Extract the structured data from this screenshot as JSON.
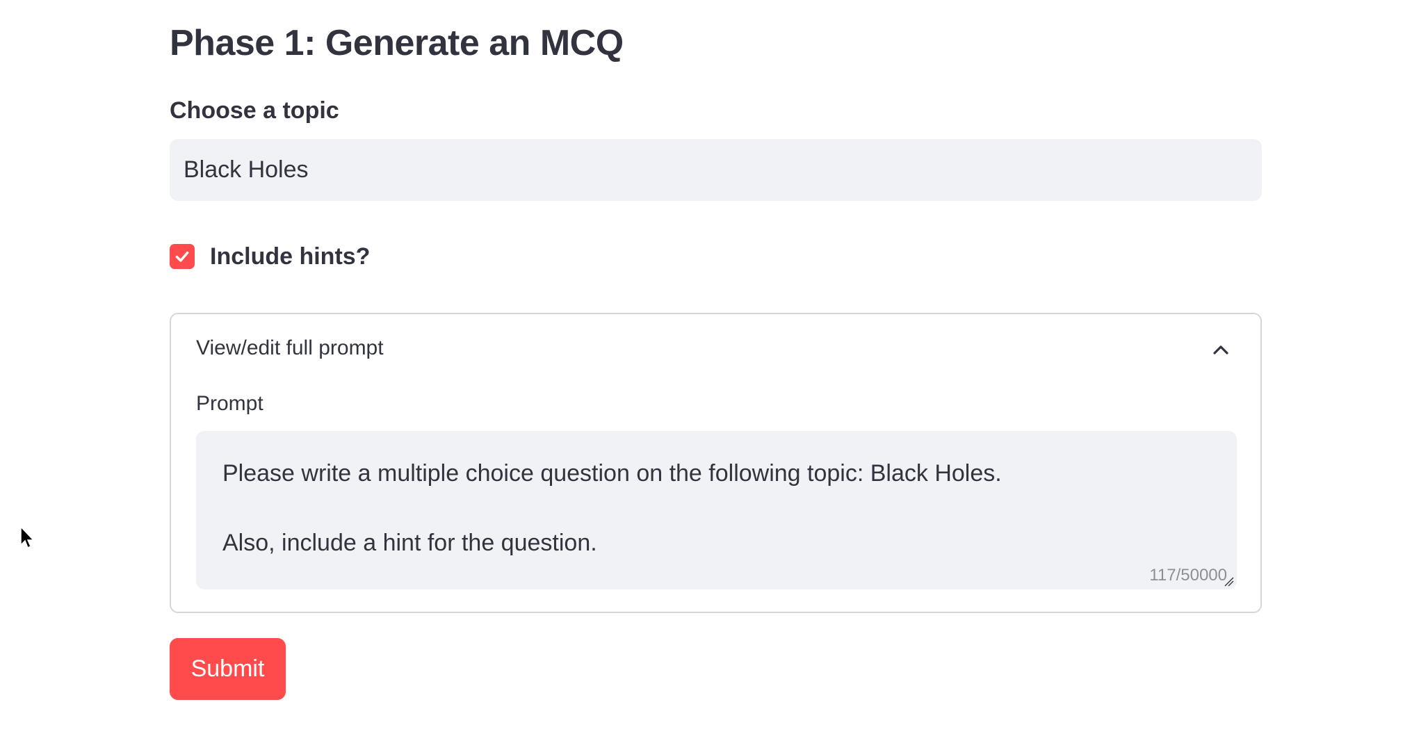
{
  "page": {
    "title": "Phase 1: Generate an MCQ"
  },
  "topic": {
    "label": "Choose a topic",
    "value": "Black Holes"
  },
  "hints": {
    "label": "Include hints?",
    "checked": true
  },
  "expander": {
    "title": "View/edit full prompt",
    "expanded": true,
    "prompt_label": "Prompt",
    "prompt_text": "Please write a multiple choice question on the following topic: Black Holes.\n\nAlso, include a hint for the question.",
    "char_count": "117/50000"
  },
  "submit": {
    "label": "Submit"
  },
  "colors": {
    "accent": "#FF4B4B",
    "text": "#31333F",
    "input_bg": "#F0F2F6",
    "border": "#D6D6D9",
    "muted": "#8E8F96"
  },
  "icons": {
    "checkbox": "check-icon",
    "expander": "chevron-up-icon",
    "cursor": "mouse-pointer-icon"
  }
}
